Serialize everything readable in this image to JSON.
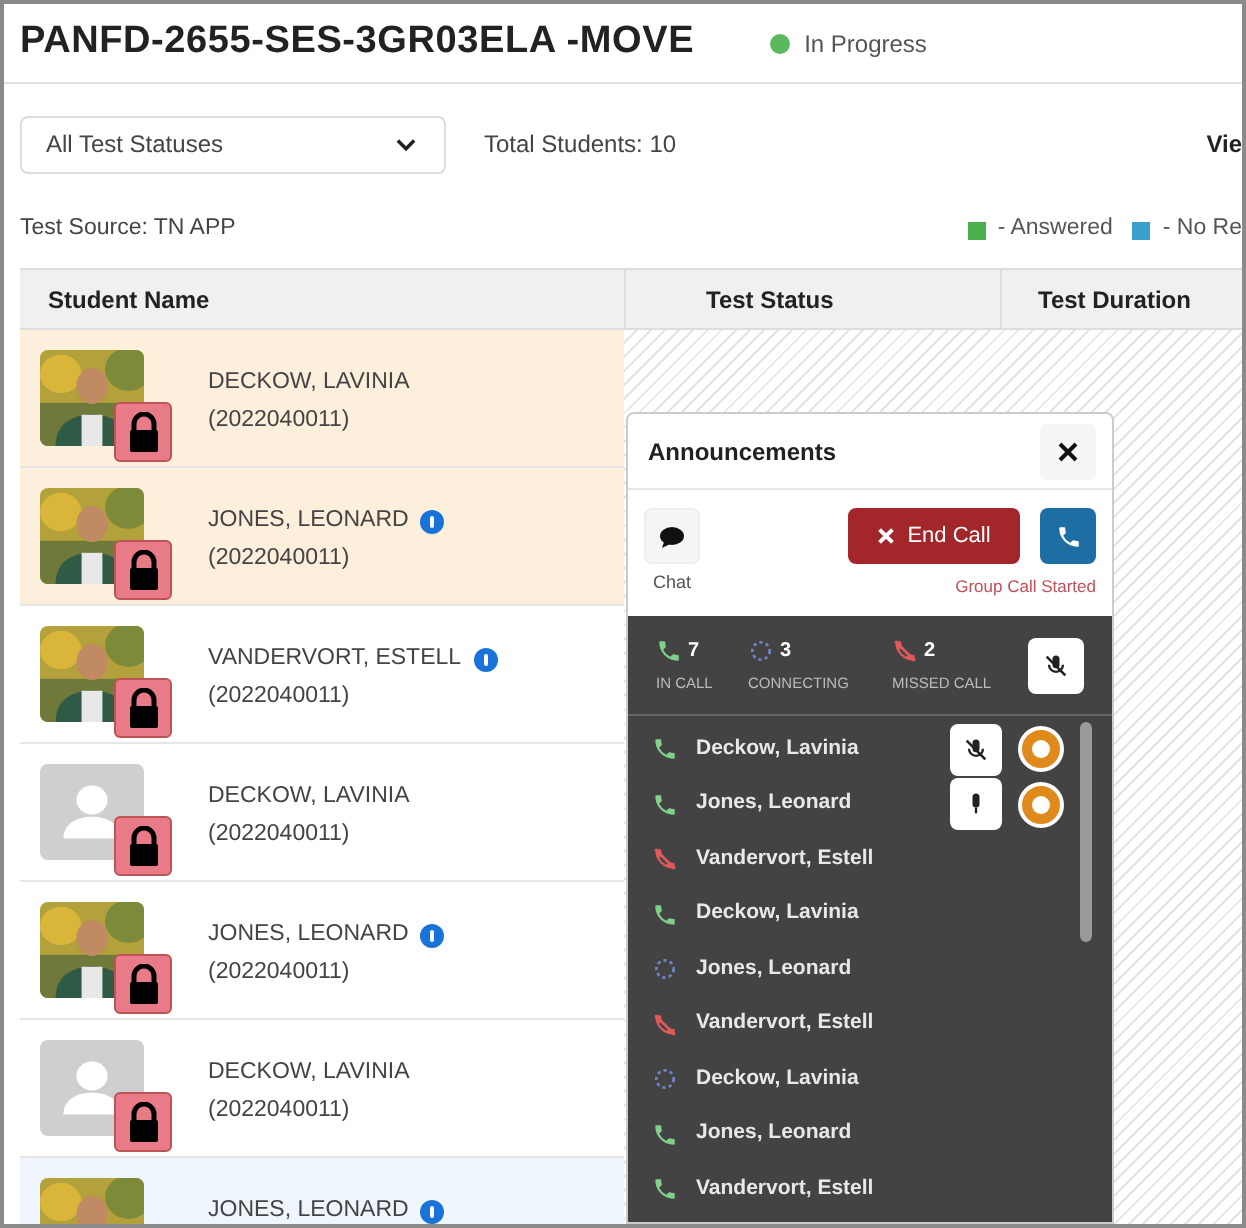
{
  "header": {
    "title": "PANFD-2655-SES-3GR03ELA -MOVE",
    "status": {
      "label": "In Progress",
      "color": "#5cb85c"
    }
  },
  "toolbar": {
    "filter": "All Test Statuses",
    "total": "Total Students: 10",
    "view": "Vie"
  },
  "test_source": "Test Source: TN APP",
  "legend": [
    {
      "label": "- Answered",
      "color": "#4caf50"
    },
    {
      "label": "- No Re",
      "color": "#3a9fc9"
    }
  ],
  "table": {
    "columns": [
      "Student Name",
      "Test Status",
      "Test Duration"
    ],
    "rows": [
      {
        "name": "DECKOW, LAVINIA",
        "id": "(2022040011)",
        "info": false,
        "locked": true,
        "flagged": true,
        "selected": false
      },
      {
        "name": "JONES, LEONARD",
        "id": "(2022040011)",
        "info": true,
        "locked": true,
        "flagged": true,
        "selected": false
      },
      {
        "name": "VANDERVORT, ESTELL",
        "id": "(2022040011)",
        "info": true,
        "locked": true,
        "flagged": false,
        "selected": false
      },
      {
        "name": "DECKOW, LAVINIA",
        "id": "(2022040011)",
        "kind": "placeholder",
        "info": false,
        "locked": true,
        "flagged": false,
        "selected": false
      },
      {
        "name": "JONES, LEONARD",
        "id": "(2022040011)",
        "info": true,
        "locked": true,
        "flagged": false,
        "selected": false
      },
      {
        "name": "DECKOW, LAVINIA",
        "id": "(2022040011)",
        "kind": "placeholder",
        "info": false,
        "locked": true,
        "flagged": false,
        "selected": false
      },
      {
        "name": "JONES, LEONARD",
        "info": true,
        "flagged": false,
        "selected": true
      }
    ]
  },
  "call_panel": {
    "title": "Announcements",
    "chat_label": "Chat",
    "end_call": "End Call",
    "call_state": "Group Call Started",
    "counts": [
      {
        "kind": "in_call",
        "count": "7",
        "label": "IN CALL"
      },
      {
        "kind": "connecting",
        "count": "3",
        "label": "CONNECTING"
      },
      {
        "kind": "missed",
        "count": "2",
        "label": "MISSED CALL"
      }
    ],
    "participants": [
      {
        "name": "Deckow, Lavinia",
        "kind": "in_call",
        "muted": true,
        "hand_raised": true
      },
      {
        "name": "Jones, Leonard",
        "kind": "in_call",
        "muted": false,
        "hand_raised": true
      },
      {
        "name": "Vandervort, Estell",
        "kind": "missed"
      },
      {
        "name": "Deckow, Lavinia",
        "kind": "in_call"
      },
      {
        "name": "Jones, Leonard",
        "kind": "connecting"
      },
      {
        "name": "Vandervort, Estell",
        "kind": "missed"
      },
      {
        "name": "Deckow, Lavinia",
        "kind": "connecting"
      },
      {
        "name": "Jones, Leonard",
        "kind": "in_call"
      },
      {
        "name": "Vandervort, Estell",
        "kind": "in_call"
      }
    ]
  }
}
